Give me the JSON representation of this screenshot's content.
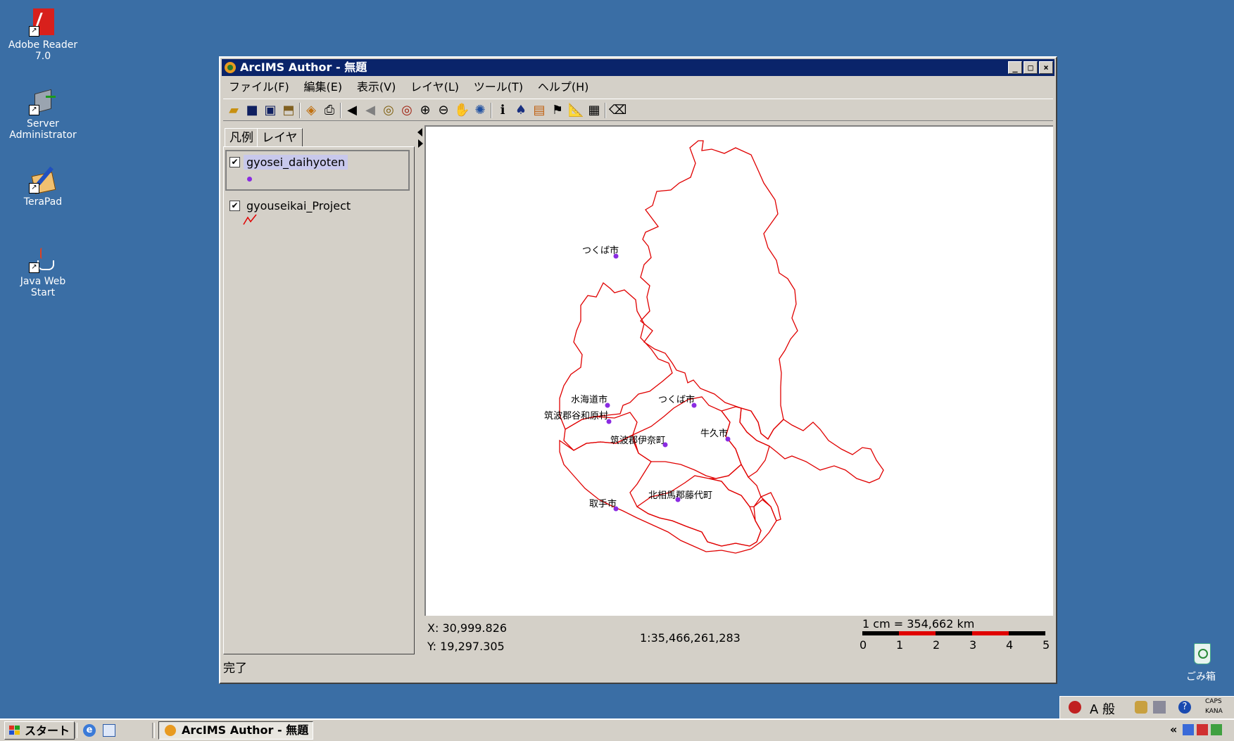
{
  "desktop": {
    "icons": [
      {
        "label": "Adobe Reader\n7.0"
      },
      {
        "label": "Server\nAdministrator"
      },
      {
        "label": "TeraPad"
      },
      {
        "label": "Java Web\nStart"
      },
      {
        "label": "ごみ箱"
      }
    ]
  },
  "window": {
    "title": "ArcIMS Author - 無題",
    "controls": {
      "minimize": "_",
      "maximize": "□",
      "close": "×"
    },
    "menus": [
      "ファイル(F)",
      "編集(E)",
      "表示(V)",
      "レイヤ(L)",
      "ツール(T)",
      "ヘルプ(H)"
    ],
    "toolbar_icons": [
      "open-icon",
      "save-icon",
      "save-as-icon",
      "export-icon",
      "add-layer-icon",
      "print-icon",
      "zoom-previous-icon",
      "zoom-next-icon",
      "zoom-full-icon",
      "zoom-active-layer-icon",
      "zoom-in-icon",
      "zoom-out-icon",
      "pan-icon",
      "globe-icon",
      "identify-icon",
      "find-icon",
      "query-icon",
      "hyperlink-icon",
      "measure-icon",
      "properties-icon",
      "eraser-icon"
    ],
    "tabs": [
      "凡例",
      "レイヤ"
    ],
    "layers": [
      {
        "name": "gyosei_daihyoten",
        "checked": true,
        "symbol": "point",
        "color": "#8a2be2"
      },
      {
        "name": "gyouseikai_Project",
        "checked": true,
        "symbol": "line",
        "color": "#e00000"
      }
    ],
    "map": {
      "labels": [
        "つくば市",
        "水海道市",
        "筑波郡谷和原村",
        "つくば市",
        "筑波郡伊奈町",
        "牛久市",
        "北相馬郡藤代町",
        "取手市"
      ],
      "boundary_color": "#e00000",
      "point_color": "#8a2be2"
    },
    "coords": {
      "x": "X: 30,999.826",
      "y": "Y: 19,297.305"
    },
    "scale_ratio": "1:35,466,261,283",
    "scale_bar": {
      "title": "1 cm = 354,662 km",
      "ticks": [
        "0",
        "1",
        "2",
        "3",
        "4",
        "5"
      ]
    },
    "status": "完了"
  },
  "taskbar": {
    "start_label": "スタート",
    "task_label": "ArcIMS Author - 無題",
    "ime": {
      "mode": "A 般",
      "caps": "CAPS",
      "kana": "KANA"
    },
    "tray_arrow": "«"
  }
}
